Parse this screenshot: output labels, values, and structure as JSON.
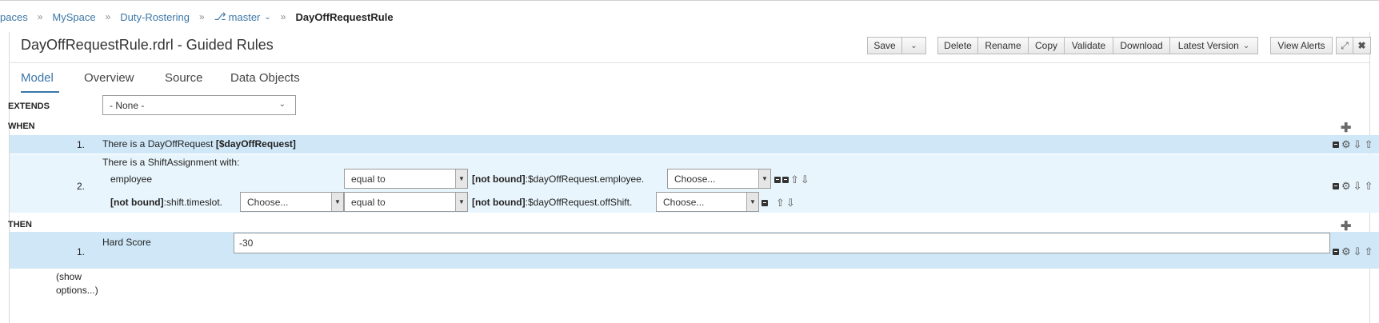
{
  "breadcrumb": {
    "items": [
      "paces",
      "MySpace",
      "Duty-Rostering"
    ],
    "branch": "master",
    "current": "DayOffRequestRule"
  },
  "editor": {
    "title": "DayOffRequestRule.rdrl - Guided Rules"
  },
  "toolbar": {
    "save": "Save",
    "delete": "Delete",
    "rename": "Rename",
    "copy": "Copy",
    "validate": "Validate",
    "download": "Download",
    "latest_version": "Latest Version",
    "view_alerts": "View Alerts"
  },
  "tabs": [
    {
      "label": "Model",
      "active": true
    },
    {
      "label": "Overview",
      "active": false
    },
    {
      "label": "Source",
      "active": false
    },
    {
      "label": "Data Objects",
      "active": false
    }
  ],
  "rule": {
    "extends_label": "EXTENDS",
    "extends_value": "- None -",
    "when_label": "WHEN",
    "then_label": "THEN",
    "when1": {
      "num": "1.",
      "text": "There is a DayOffRequest ",
      "binding": "[$dayOffRequest]"
    },
    "when2": {
      "num": "2.",
      "header": "There is a ShiftAssignment with:",
      "line1": {
        "field": "employee",
        "operator": "equal to",
        "notbound": "[not bound]",
        "expr": ":$dayOffRequest.employee.",
        "choose": "Choose..."
      },
      "line2": {
        "notbound": "[not bound]",
        "field": ":shift.timeslot.",
        "choose": "Choose...",
        "operator": "equal to",
        "notbound2": "[not bound]",
        "expr": ":$dayOffRequest.offShift.",
        "choose2": "Choose..."
      }
    },
    "then1": {
      "num": "1.",
      "label": "Hard Score",
      "value": "-30"
    },
    "show_options": "(show options...)"
  },
  "icons": {
    "branch": "branch-icon",
    "expand": "expand-icon",
    "close": "close-icon",
    "add": "plus-icon",
    "remove": "remove-icon",
    "move_up": "arrow-up-icon",
    "move_down": "arrow-down-icon",
    "insert": "insert-icon"
  },
  "colors": {
    "accent": "#3b77a8",
    "row_highlight": "#cfe7f7",
    "row_light": "#e9f5fc"
  }
}
